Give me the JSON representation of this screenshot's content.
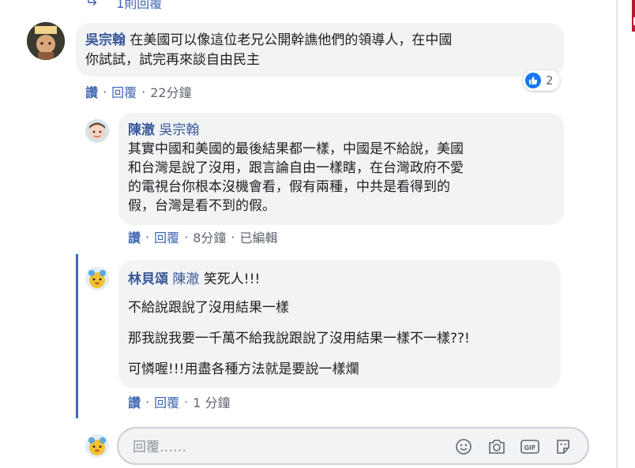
{
  "previous_reply": {
    "label": "1則回覆"
  },
  "comment1": {
    "author": "吳宗翰",
    "text_line1": "在美國可以像這位老兄公開幹譙他們的領導人，在中國",
    "text_line2": "你試試，試完再來談自由民主",
    "like_label": "讚",
    "reply_label": "回覆",
    "time": "22分鐘",
    "reaction_count": "2"
  },
  "reply1": {
    "author": "陳澈",
    "mention": "吳宗翰",
    "lines": [
      "其實中國和美國的最後結果都一樣，中國是不給說，美國",
      "和台灣是說了沒用，跟言論自由一樣瞎，在台灣政府不愛",
      "的電視台你根本沒機會看，假有兩種，中共是看得到的",
      "假，台灣是看不到的假。"
    ],
    "like_label": "讚",
    "reply_label": "回覆",
    "time": "8分鐘",
    "edited": "已編輯"
  },
  "reply2": {
    "author": "林貝頌",
    "mention": "陳澈",
    "first_text": "笑死人!!!",
    "paragraphs": [
      "不給說跟說了沒用結果一樣",
      "那我說我要一千萬不給我說跟說了沒用結果一樣不一樣??!",
      "可憐喔!!!用盡各種方法就是要說一樣爛"
    ],
    "like_label": "讚",
    "reply_label": "回覆",
    "time": "1 分鐘"
  },
  "reply_box": {
    "placeholder": "回覆……"
  },
  "icons": [
    "reply-arrow-icon",
    "like-icon",
    "emoji-icon",
    "camera-icon",
    "gif-icon",
    "sticker-icon"
  ],
  "colors": {
    "link": "#385898",
    "action": "#4267b2",
    "bubble": "#f2f3f5",
    "like": "#1877f2",
    "thread_line": "#4267b2"
  }
}
